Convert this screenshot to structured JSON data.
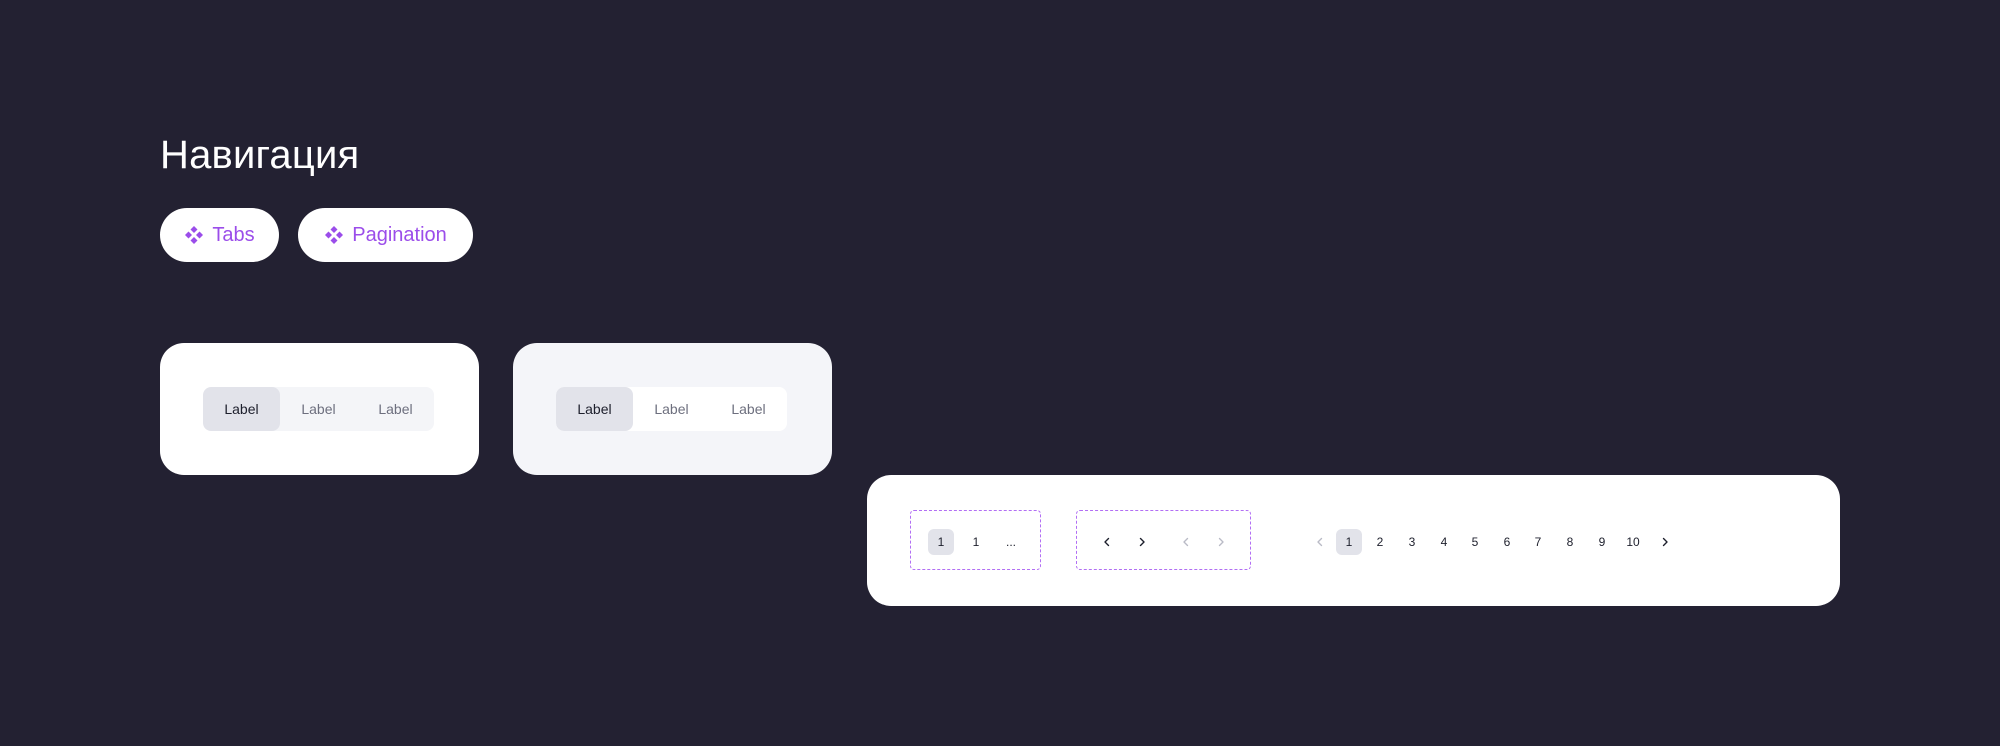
{
  "page": {
    "title": "Навигация"
  },
  "links": [
    {
      "label": "Tabs",
      "icon": "component-icon"
    },
    {
      "label": "Pagination",
      "icon": "component-icon"
    }
  ],
  "colors": {
    "background": "#232132",
    "accent": "#9b4dea",
    "dashed_border": "#b26ff4",
    "active_item": "#e2e3ea"
  },
  "tabs_on_white": {
    "items": [
      {
        "label": "Label",
        "active": true
      },
      {
        "label": "Label",
        "active": false
      },
      {
        "label": "Label",
        "active": false
      }
    ]
  },
  "tabs_on_gray": {
    "items": [
      {
        "label": "Label",
        "active": true
      },
      {
        "label": "Label",
        "active": false
      },
      {
        "label": "Label",
        "active": false
      }
    ]
  },
  "pagination": {
    "compact": {
      "items": [
        "1",
        "1",
        "..."
      ],
      "active_index": 0
    },
    "arrows": [
      {
        "icon": "chevron-left-icon",
        "disabled": false
      },
      {
        "icon": "chevron-right-icon",
        "disabled": false
      },
      {
        "icon": "chevron-left-icon",
        "disabled": true
      },
      {
        "icon": "chevron-right-icon",
        "disabled": true
      }
    ],
    "full": {
      "pages": [
        "1",
        "2",
        "3",
        "4",
        "5",
        "6",
        "7",
        "8",
        "9",
        "10"
      ],
      "active_page": "1",
      "prev_disabled": true,
      "next_disabled": false
    }
  }
}
